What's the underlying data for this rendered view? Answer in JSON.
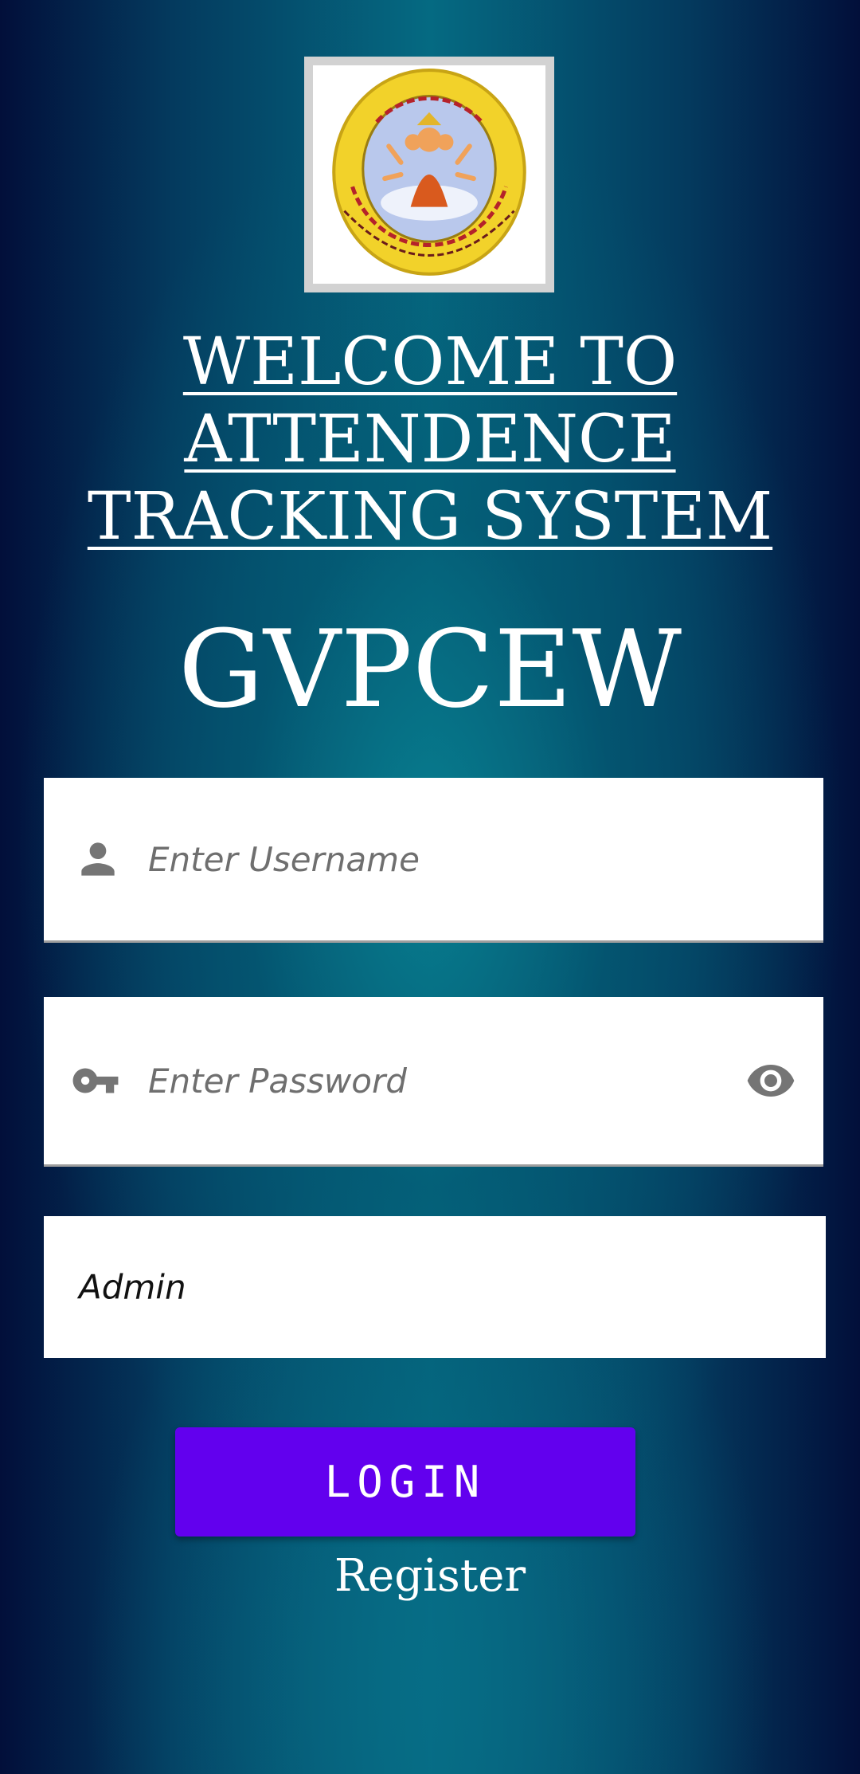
{
  "logo": {
    "icon": "college-emblem",
    "colors": {
      "ring": "#f2d22a",
      "ring_outline": "#c8a415",
      "center": "#b9c8ec",
      "deity": "#d95a1e",
      "ring_text": "#b5222a"
    }
  },
  "header": {
    "welcome_title": "WELCOME TO ATTENDENCE TRACKING SYSTEM",
    "brand": "GVPCEW"
  },
  "form": {
    "username": {
      "icon": "person-icon",
      "placeholder": "Enter Username",
      "value": ""
    },
    "password": {
      "icon": "key-icon",
      "placeholder": "Enter Password",
      "value": "",
      "toggle_icon": "eye-icon"
    },
    "role": {
      "selected": "Admin"
    },
    "login_label": "LOGIN",
    "register_label": "Register"
  },
  "colors": {
    "primary_button": "#6200ee",
    "icon_gray": "#757575",
    "text_white": "#ffffff"
  }
}
